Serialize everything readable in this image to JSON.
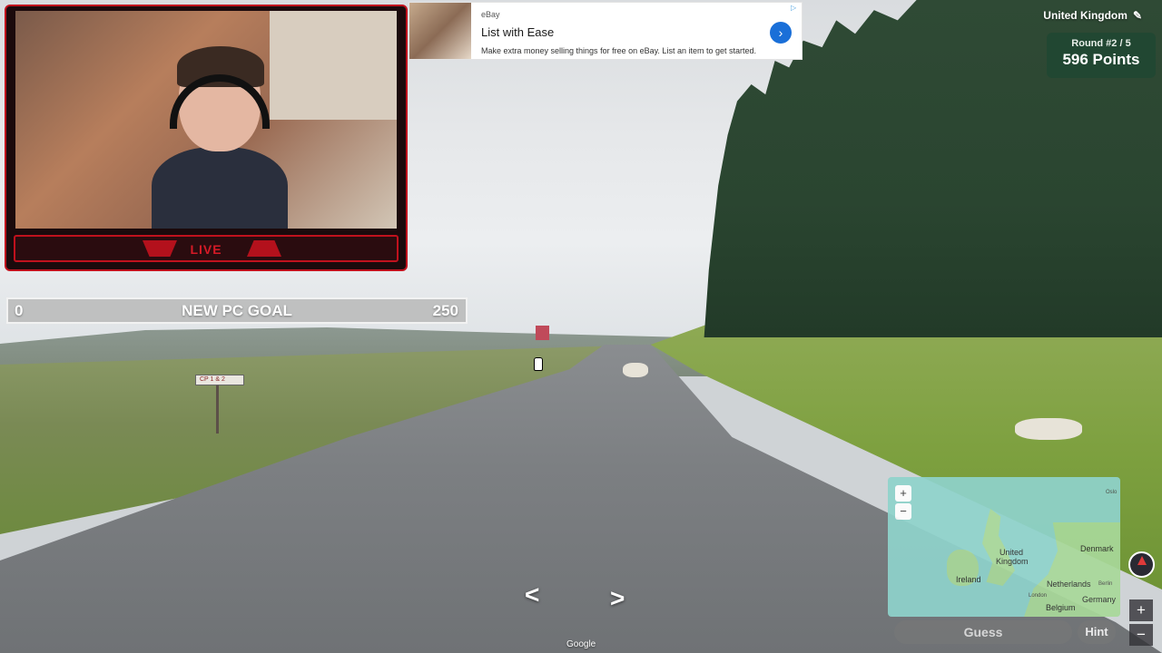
{
  "webcam": {
    "live_label": "LIVE"
  },
  "goal": {
    "min": "0",
    "label": "NEW PC GOAL",
    "max": "250"
  },
  "ad": {
    "source": "eBay",
    "title": "List with Ease",
    "description": "Make extra money selling things for free on eBay. List an item to get started.",
    "cta_icon": "chevron-right-icon",
    "adchoices_icon": "adchoices-icon"
  },
  "hud": {
    "country": "United Kingdom",
    "edit_icon": "pencil-icon",
    "round": "Round #2 / 5",
    "points": "596 Points"
  },
  "minimap": {
    "labels": {
      "uk": "United Kingdom",
      "ireland": "Ireland",
      "denmark": "Denmark",
      "netherlands": "Netherlands",
      "germany": "Germany",
      "belgium": "Belgium",
      "london": "London",
      "berlin": "Berlin",
      "oslo": "Oslo"
    },
    "zoom_in": "+",
    "zoom_out": "−"
  },
  "buttons": {
    "guess": "Guess",
    "hint": "Hint",
    "zoom_in": "+",
    "zoom_out": "−"
  },
  "nav": {
    "left_arrow": "<",
    "right_arrow": ">"
  },
  "attribution": "Google",
  "scene": {
    "road_sign": "CP 1 & 2"
  },
  "colors": {
    "accent_red": "#c0111d",
    "score_bg": "#1e4632",
    "ad_button": "#1a6fd8"
  }
}
